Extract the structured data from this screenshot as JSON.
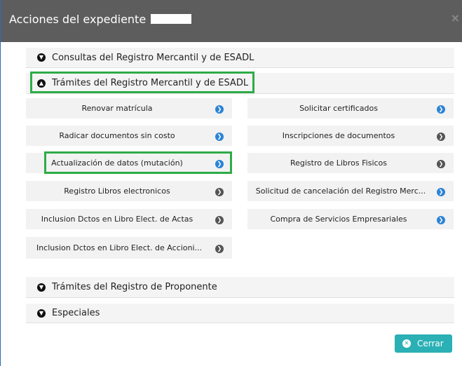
{
  "dialog": {
    "title": "Acciones del expediente",
    "close_glyph": "×",
    "close_label": "Cerrar"
  },
  "sections": [
    {
      "label": "Consultas del Registro Mercantil y de ESADL",
      "icon": "chevron-down-circle-icon",
      "expanded": false
    },
    {
      "label": "Trámites del Registro Mercantil y de ESADL",
      "icon": "chevron-up-circle-icon",
      "expanded": true
    },
    {
      "label": "Trámites del Registro de Proponente",
      "icon": "chevron-down-circle-icon",
      "expanded": false
    },
    {
      "label": "Especiales",
      "icon": "chevron-down-circle-icon",
      "expanded": false
    }
  ],
  "actions": [
    {
      "label": "Renovar matrícula",
      "dot": "blue"
    },
    {
      "label": "Solicitar certificados",
      "dot": "blue"
    },
    {
      "label": "Radicar documentos sin costo",
      "dot": "blue"
    },
    {
      "label": "Inscripciones de documentos",
      "dot": "gray"
    },
    {
      "label": "Actualización de datos (mutación)",
      "dot": "blue"
    },
    {
      "label": "Registro de Libros Fisicos",
      "dot": "gray"
    },
    {
      "label": "Registro Libros electronicos",
      "dot": "gray"
    },
    {
      "label": "Solicitud de cancelación del Registro Merc...",
      "dot": "blue"
    },
    {
      "label": "Inclusion Dctos en Libro Elect. de Actas",
      "dot": "gray"
    },
    {
      "label": "Compra de Servicios Empresariales",
      "dot": "blue"
    },
    {
      "label": "Inclusion Dctos en Libro Elect. de Accioni...",
      "dot": "gray"
    }
  ],
  "colors": {
    "header_bg": "#5d5d5d",
    "highlight": "#2eac47",
    "dot_blue": "#2c84d6",
    "dot_gray": "#555555",
    "button_bg": "#2ab0b5"
  }
}
